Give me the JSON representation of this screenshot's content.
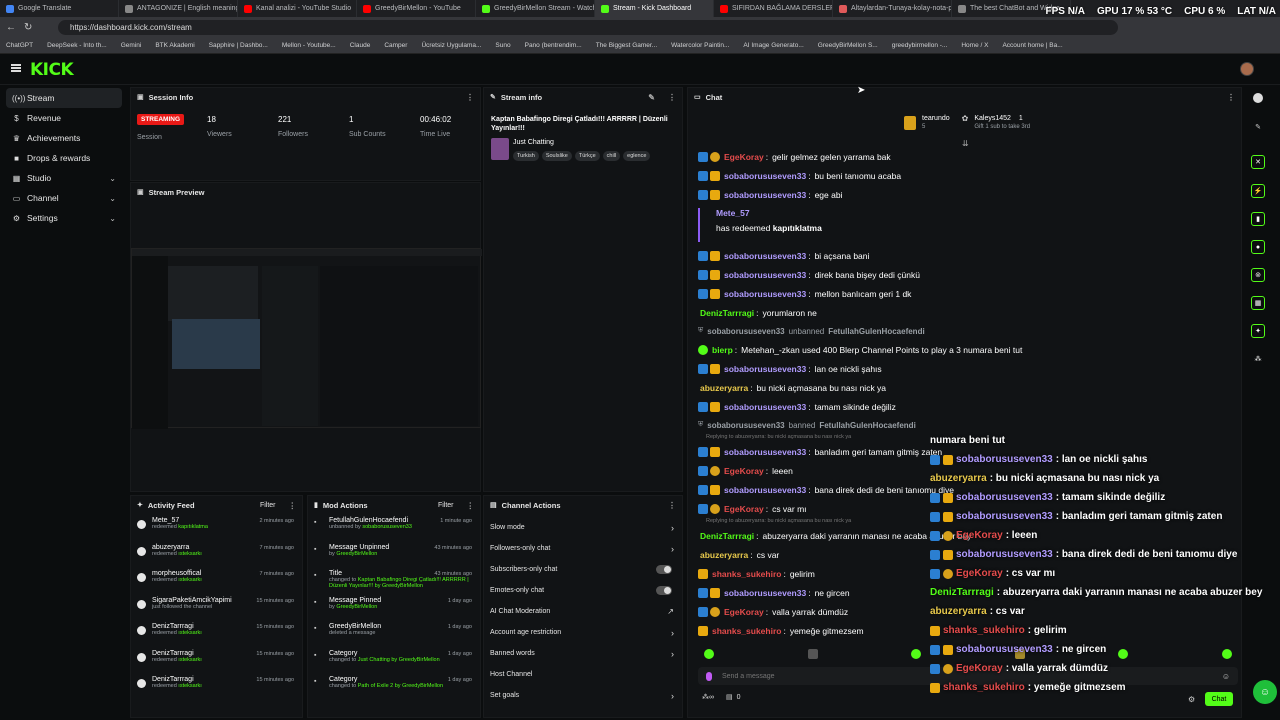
{
  "browser": {
    "tabs": [
      {
        "label": "Google Translate",
        "color": "#4285f4"
      },
      {
        "label": "ANTAGONIZE | English meaning",
        "color": "#888888"
      },
      {
        "label": "Kanal analizi - YouTube Studio",
        "color": "#ff0000"
      },
      {
        "label": "GreedyBirMellon - YouTube",
        "color": "#ff0000"
      },
      {
        "label": "GreedyBirMellon Stream - Watch",
        "color": "#53fc18"
      },
      {
        "label": "Stream - Kick Dashboard",
        "color": "#53fc18"
      },
      {
        "label": "SIFIRDAN BAĞLAMA DERSLERİ 6",
        "color": "#ff0000"
      },
      {
        "label": "Altaylardan-Tunaya-kolay-nota-p",
        "color": "#e05a5a"
      },
      {
        "label": "The best ChatBot and Widge",
        "color": "#888888"
      }
    ],
    "url": "https://dashboard.kick.com/stream",
    "bookmarks": [
      "ChatGPT",
      "DeepSeek - Into th...",
      "Gemini",
      "BTK Akademi",
      "Sapphire | Dashbo...",
      "Mellon - Youtube...",
      "Claude",
      "Camper",
      "Ücretsiz Uygulama...",
      "Suno",
      "Pano (bentrendim...",
      "The Biggest Gamer...",
      "Watercolor Paintin...",
      "AI Image Generato...",
      "GreedyBirMellon S...",
      "greedybirmellon -...",
      "Home / X",
      "Account home | Ba..."
    ],
    "overlay_stats": {
      "fps_label": "FPS",
      "fps_value": "N/A",
      "gpu_label": "GPU",
      "gpu_value": "17 % 53 °C",
      "cpu_label": "CPU",
      "cpu_value": "6 %",
      "lat_label": "LAT",
      "lat_value": "N/A"
    }
  },
  "kick": {
    "logo": "KICK",
    "sidebar": [
      {
        "label": "Stream",
        "icon": "broadcast-icon",
        "glyph": "((•))"
      },
      {
        "label": "Revenue",
        "icon": "dollar-icon",
        "glyph": "$"
      },
      {
        "label": "Achievements",
        "icon": "trophy-icon",
        "glyph": "♛"
      },
      {
        "label": "Drops & rewards",
        "icon": "gift-icon",
        "glyph": "■"
      },
      {
        "label": "Studio",
        "icon": "studio-icon",
        "glyph": "▦",
        "chevron": "⌄"
      },
      {
        "label": "Channel",
        "icon": "channel-icon",
        "glyph": "▭",
        "chevron": "⌄"
      },
      {
        "label": "Settings",
        "icon": "gear-icon",
        "glyph": "⚙",
        "chevron": "⌄"
      }
    ],
    "session": {
      "title": "Session Info",
      "badge": "STREAMING",
      "session_label": "Session",
      "stats": [
        {
          "value": "18",
          "label": "Viewers"
        },
        {
          "value": "221",
          "label": "Followers"
        },
        {
          "value": "1",
          "label": "Sub Counts"
        },
        {
          "value": "00:46:02",
          "label": "Time Live"
        }
      ]
    },
    "stream_info": {
      "title": "Stream info",
      "stream_title": "Kaptan Babafingo Diregi Çatladı!!! ARRRRR | Düzenli Yayınlar!!!",
      "category": "Just Chatting",
      "tags": [
        "Turkish",
        "Soulslike",
        "Türkçe",
        "chill",
        "eglence"
      ]
    },
    "preview": {
      "title": "Stream Preview"
    },
    "activity": {
      "title": "Activity Feed",
      "filter": "Filter",
      "items": [
        {
          "name": "Mete_57",
          "pre": "redeemed ",
          "reward": "kapıtıklatma",
          "time": "2 minutes ago"
        },
        {
          "name": "abuzeryarra",
          "pre": "redeemed ",
          "reward": "ısteksarkı",
          "time": "7 minutes ago"
        },
        {
          "name": "morpheusoffical",
          "pre": "redeemed ",
          "reward": "ısteksarkı",
          "time": "7 minutes ago"
        },
        {
          "name": "SigaraPaketiAmcikYapimi",
          "pre": "just followed the channel",
          "reward": "",
          "time": "15 minutes ago"
        },
        {
          "name": "DenizTarrragi",
          "pre": "redeemed ",
          "reward": "ısteksarkı",
          "time": "15 minutes ago"
        },
        {
          "name": "DenizTarrragi",
          "pre": "redeemed ",
          "reward": "ısteksarkı",
          "time": "15 minutes ago"
        },
        {
          "name": "DenizTarrragi",
          "pre": "redeemed ",
          "reward": "ısteksarkı",
          "time": "15 minutes ago"
        }
      ]
    },
    "mod_actions": {
      "title": "Mod Actions",
      "filter": "Filter",
      "items": [
        {
          "name": "FetullahGulenHocaefendi",
          "sub": "unbanned by ",
          "who": "sobaborususeven33",
          "time": "1 minute ago"
        },
        {
          "name": "Message Unpinned",
          "sub": "by ",
          "who": "GreedyBirMellon",
          "time": "43 minutes ago"
        },
        {
          "name": "Title",
          "sub": "changed to ",
          "who": "Kaptan Babafingo Diregi Çatladı!!! ARRRRR | Düzenli Yayınlar!!! by GreedyBirMellon",
          "time": "43 minutes ago"
        },
        {
          "name": "Message Pinned",
          "sub": "by ",
          "who": "GreedyBirMellon",
          "time": "1 day ago"
        },
        {
          "name": "GreedyBirMellon",
          "sub": "deleted a message",
          "who": "",
          "time": "1 day ago"
        },
        {
          "name": "Category",
          "sub": "changed to ",
          "who": "Just Chatting by GreedyBirMellon",
          "time": "1 day ago"
        },
        {
          "name": "Category",
          "sub": "changed to ",
          "who": "Path of Exile 2 by GreedyBirMellon",
          "time": "1 day ago"
        }
      ]
    },
    "channel_actions": {
      "title": "Channel Actions",
      "items": [
        {
          "label": "Slow mode",
          "control": "chevron"
        },
        {
          "label": "Followers-only chat",
          "control": "chevron"
        },
        {
          "label": "Subscribers-only chat",
          "control": "toggle"
        },
        {
          "label": "Emotes-only chat",
          "control": "toggle"
        },
        {
          "label": "AI Chat Moderation",
          "control": "external"
        },
        {
          "label": "Account age restriction",
          "control": "chevron"
        },
        {
          "label": "Banned words",
          "control": "chevron"
        },
        {
          "label": "Host Channel",
          "control": "none"
        },
        {
          "label": "Set goals",
          "control": "chevron"
        }
      ]
    },
    "chat": {
      "title": "Chat",
      "top_gifter": {
        "name": "tearundo",
        "count": "5"
      },
      "gift_user": {
        "name": "Kaleys1452",
        "count": "1",
        "caption": "Gift 1 sub to take 3rd"
      },
      "input_placeholder": "Send a message",
      "chat_button": "Chat",
      "footer_count": "0",
      "messages": [
        {
          "user": "EgeKoray",
          "color": "#e44c4c",
          "badges": [
            "blue",
            "gold"
          ],
          "text": "gelir gelmez gelen yarrama bak"
        },
        {
          "user": "sobaborususeven33",
          "color": "#b19cff",
          "badges": [
            "blue",
            "crown"
          ],
          "text": "bu beni tanıomu acaba"
        },
        {
          "user": "sobaborususeven33",
          "color": "#b19cff",
          "badges": [
            "blue",
            "crown"
          ],
          "text": "ege abi"
        },
        {
          "type": "redeem",
          "user": "Mete_57",
          "text": "has redeemed ",
          "reward": "kapıtıklatma"
        },
        {
          "user": "sobaborususeven33",
          "color": "#b19cff",
          "badges": [
            "blue",
            "crown"
          ],
          "text": "bi açsana bani"
        },
        {
          "user": "sobaborususeven33",
          "color": "#b19cff",
          "badges": [
            "blue",
            "crown"
          ],
          "text": "direk bana bişey dedi çünkü"
        },
        {
          "user": "sobaborususeven33",
          "color": "#b19cff",
          "badges": [
            "blue",
            "crown"
          ],
          "text": "mellon banlıcam geri 1 dk"
        },
        {
          "user": "DenizTarrragi",
          "color": "#53fc18",
          "badges": [],
          "text": "yorumlaron ne"
        },
        {
          "type": "mod",
          "user": "sobaborususeven33",
          "action": "unbanned",
          "target": "FetullahGulenHocaefendi"
        },
        {
          "user": "bierp",
          "color": "#53fc18",
          "badges": [
            "green"
          ],
          "text": "Metehan_-zkan used 400 Blerp Channel Points to play a 3 numara beni tut"
        },
        {
          "user": "sobaborususeven33",
          "color": "#b19cff",
          "badges": [
            "blue",
            "crown"
          ],
          "text": "lan oe nickli şahıs"
        },
        {
          "user": "abuzeryarra",
          "color": "#e8c94c",
          "badges": [],
          "text": "bu nicki açmasana bu nası nick ya"
        },
        {
          "user": "sobaborususeven33",
          "color": "#b19cff",
          "badges": [
            "blue",
            "crown"
          ],
          "text": "tamam sikinde değiliz"
        },
        {
          "type": "mod",
          "user": "sobaborususeven33",
          "action": "banned",
          "target": "FetullahGulenHocaefendi"
        },
        {
          "type": "reply",
          "text": "Replying to abuzeryarra: bu nicki açmasana bu nası nick ya"
        },
        {
          "user": "sobaborususeven33",
          "color": "#b19cff",
          "badges": [
            "blue",
            "crown"
          ],
          "text": "banladım geri tamam gitmiş zaten"
        },
        {
          "user": "EgeKoray",
          "color": "#e44c4c",
          "badges": [
            "blue",
            "gold"
          ],
          "text": "leeen"
        },
        {
          "user": "sobaborususeven33",
          "color": "#b19cff",
          "badges": [
            "blue",
            "crown"
          ],
          "text": "bana direk dedi de beni tanıomu diye"
        },
        {
          "user": "EgeKoray",
          "color": "#e44c4c",
          "badges": [
            "blue",
            "gold"
          ],
          "text": "cs var mı"
        },
        {
          "type": "reply",
          "text": "Replying to abuzeryarra: bu nicki açmasana bu nası nick ya"
        },
        {
          "user": "DenizTarrragi",
          "color": "#53fc18",
          "badges": [],
          "text": "abuzeryarra daki yarranın manası ne acaba abuzer bey"
        },
        {
          "user": "abuzeryarra",
          "color": "#e8c94c",
          "badges": [],
          "text": "cs var"
        },
        {
          "user": "shanks_sukehiro",
          "color": "#e44c4c",
          "badges": [
            "crown"
          ],
          "text": "gelirim"
        },
        {
          "user": "sobaborususeven33",
          "color": "#b19cff",
          "badges": [
            "blue",
            "crown"
          ],
          "text": "ne gircen"
        },
        {
          "user": "EgeKoray",
          "color": "#e44c4c",
          "badges": [
            "blue",
            "gold"
          ],
          "text": "valla yarrak dümdüz"
        },
        {
          "user": "shanks_sukehiro",
          "color": "#e44c4c",
          "badges": [
            "crown"
          ],
          "text": "yemeğe gitmezsem"
        }
      ]
    },
    "overlay_chat": [
      {
        "user": "",
        "color": "#ffffff",
        "badges": [],
        "text": "numara beni tut"
      },
      {
        "user": "sobaborususeven33",
        "color": "#b19cff",
        "badges": [
          "blue",
          "crown"
        ],
        "text": ": lan oe nickli şahıs"
      },
      {
        "user": "abuzeryarra",
        "color": "#e8c94c",
        "badges": [],
        "text": ": bu nicki açmasana bu nası nick ya"
      },
      {
        "user": "sobaborususeven33",
        "color": "#b19cff",
        "badges": [
          "blue",
          "crown"
        ],
        "text": ": tamam sikinde değiliz"
      },
      {
        "user": "sobaborususeven33",
        "color": "#b19cff",
        "badges": [
          "blue",
          "crown"
        ],
        "text": ": banladım geri tamam gitmiş zaten"
      },
      {
        "user": "EgeKoray",
        "color": "#e44c4c",
        "badges": [
          "blue",
          "gold"
        ],
        "text": ": leeen"
      },
      {
        "user": "sobaborususeven33",
        "color": "#b19cff",
        "badges": [
          "blue",
          "crown"
        ],
        "text": ": bana direk dedi de beni tanıomu diye"
      },
      {
        "user": "EgeKoray",
        "color": "#e44c4c",
        "badges": [
          "blue",
          "gold"
        ],
        "text": ": cs var mı"
      },
      {
        "user": "DenizTarrragi",
        "color": "#53fc18",
        "badges": [],
        "text": ": abuzeryarra daki yarranın manası ne acaba abuzer bey"
      },
      {
        "user": "abuzeryarra",
        "color": "#e8c94c",
        "badges": [],
        "text": ": cs var"
      },
      {
        "user": "shanks_sukehiro",
        "color": "#e44c4c",
        "badges": [
          "crown"
        ],
        "text": ": gelirim"
      },
      {
        "user": "sobaborususeven33",
        "color": "#b19cff",
        "badges": [
          "blue",
          "crown"
        ],
        "text": ": ne gircen"
      },
      {
        "user": "EgeKoray",
        "color": "#e44c4c",
        "badges": [
          "blue",
          "gold"
        ],
        "text": ": valla yarrak dümdüz"
      },
      {
        "user": "shanks_sukehiro",
        "color": "#e44c4c",
        "badges": [
          "crown"
        ],
        "text": ": yemeğe gitmezsem"
      }
    ],
    "accent": "#53fc18"
  }
}
